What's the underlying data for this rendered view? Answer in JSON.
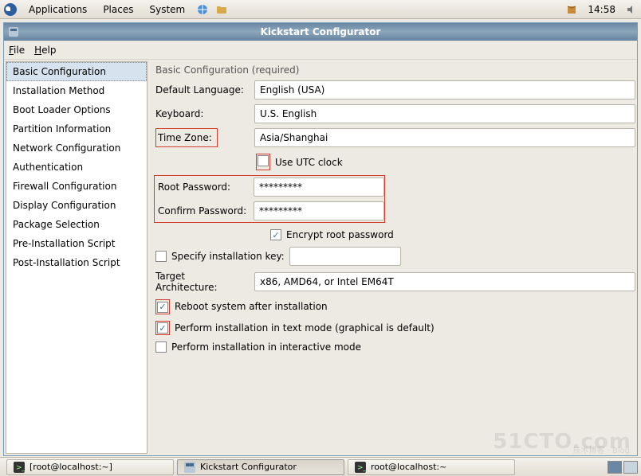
{
  "topPanel": {
    "applications": "Applications",
    "places": "Places",
    "system": "System",
    "clock": "14:58"
  },
  "window": {
    "title": "Kickstart Configurator"
  },
  "menubar": {
    "file": "File",
    "help": "Help"
  },
  "sidebar": {
    "items": [
      "Basic Configuration",
      "Installation Method",
      "Boot Loader Options",
      "Partition Information",
      "Network Configuration",
      "Authentication",
      "Firewall Configuration",
      "Display Configuration",
      "Package Selection",
      "Pre-Installation Script",
      "Post-Installation Script"
    ],
    "selectedIndex": 0
  },
  "form": {
    "sectionTitle": "Basic Configuration (required)",
    "labels": {
      "defaultLanguage": "Default Language:",
      "keyboard": "Keyboard:",
      "timeZone": "Time Zone:",
      "useUtc": "Use UTC clock",
      "rootPassword": "Root Password:",
      "confirmPassword": "Confirm Password:",
      "encrypt": "Encrypt root password",
      "specifyKey": "Specify installation key:",
      "targetArch": "Target Architecture:",
      "reboot": "Reboot system after installation",
      "textMode": "Perform installation in text mode (graphical is default)",
      "interactive": "Perform installation in interactive mode"
    },
    "values": {
      "defaultLanguage": "English (USA)",
      "keyboard": "U.S. English",
      "timeZone": "Asia/Shanghai",
      "rootPassword": "*********",
      "confirmPassword": "*********",
      "targetArch": "x86, AMD64, or Intel EM64T",
      "installKey": ""
    },
    "checks": {
      "useUtc": false,
      "encrypt": true,
      "specifyKey": false,
      "reboot": true,
      "textMode": true,
      "interactive": false
    }
  },
  "taskbar": {
    "items": [
      "[root@localhost:~]",
      "Kickstart Configurator",
      "root@localhost:~"
    ]
  },
  "watermark": "51CTO.com",
  "watermarkSub": "技术博客 · Blog"
}
